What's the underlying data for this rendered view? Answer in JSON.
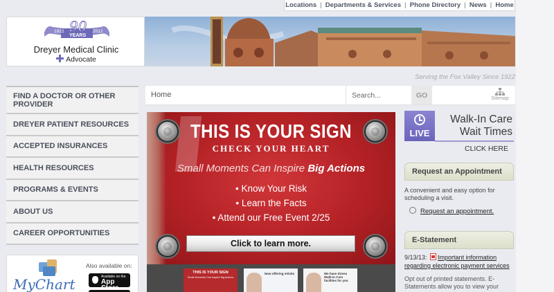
{
  "top_nav": {
    "items": [
      "Locations",
      "Departments & Services",
      "Phone Directory",
      "News",
      "Home"
    ],
    "separator": "|"
  },
  "logo": {
    "anniversary_years": [
      "1922",
      "90",
      "2012"
    ],
    "anniversary_word": "YEARS",
    "clinic_name": "Dreyer Medical Clinic",
    "affiliate": "Advocate"
  },
  "banner": {
    "tagline": "Serving the Fox Valley Since 1922"
  },
  "left_nav": {
    "items": [
      {
        "label": "FIND A DOCTOR OR OTHER PROVIDER"
      },
      {
        "label": "DREYER PATIENT RESOURCES"
      },
      {
        "label": "ACCEPTED INSURANCES"
      },
      {
        "label": "HEALTH RESOURCES"
      },
      {
        "label": "PROGRAMS & EVENTS"
      },
      {
        "label": "ABOUT US"
      },
      {
        "label": "CAREER OPPORTUNITIES"
      }
    ]
  },
  "mychart": {
    "brand": "MyChart",
    "also_available": "Also available on:",
    "appstore_small": "Available on the",
    "appstore_big": "App Store"
  },
  "search": {
    "breadcrumb": "Home",
    "placeholder": "Search...",
    "go_label": "GO",
    "sitemap_label": "Sitemap"
  },
  "hero": {
    "title": "THIS IS YOUR SIGN",
    "subtitle": "CHECK YOUR HEART",
    "tagline_plain": "Small Moments Can Inspire ",
    "tagline_bold": "Big Actions",
    "bullets": [
      "• Know Your Risk",
      "• Learn the Facts",
      "• Attend our Free Event 2/25"
    ],
    "button_label": "Click to learn more."
  },
  "thumbnails": {
    "t1_title": "THIS IS YOUR SIGN",
    "t1_sub": "Small Moments Can Inspire Big Actions",
    "t2_title": "Now offering eVisits",
    "t3_title": "We have Stress Walk-In Care facilities for you"
  },
  "walkin": {
    "badge": "LIVE",
    "title_line1": "Walk-In Care",
    "title_line2": "Wait Times",
    "click_here": "CLICK HERE"
  },
  "appointment": {
    "heading": "Request an Appointment",
    "description": "A convenient and easy option for scheduling a visit.",
    "link": "Request an appointment."
  },
  "estatement": {
    "heading": "E-Statement",
    "news_date": "9/13/13:",
    "news_link": "Important information regarding electronic payment services",
    "description": "Opt out of printed statements. E-Statements allow you to view your"
  },
  "colors": {
    "accent_purple": "#6d6ab8",
    "hero_red": "#b32125",
    "panel_beige": "#dcdfcb"
  }
}
